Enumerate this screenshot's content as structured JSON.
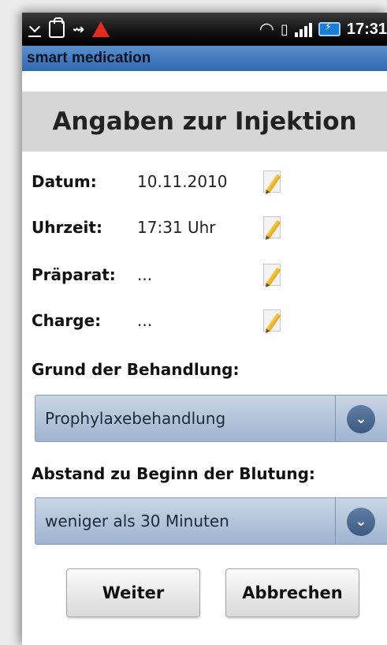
{
  "status_bar": {
    "time": "17:31",
    "icons": [
      "download-icon",
      "shopping-bag-icon",
      "usb-icon",
      "warning-icon",
      "wifi-icon",
      "vibrate-icon",
      "signal-icon",
      "battery-charging-icon"
    ]
  },
  "app": {
    "title": "smart medication"
  },
  "screen": {
    "heading": "Angaben zur Injektion"
  },
  "fields": [
    {
      "label": "Datum:",
      "value": "10.11.2010"
    },
    {
      "label": "Uhrzeit:",
      "value": "17:31 Uhr"
    },
    {
      "label": "Präparat:",
      "value": "..."
    },
    {
      "label": "Charge:",
      "value": "..."
    }
  ],
  "treatment_reason": {
    "label": "Grund der Behandlung:",
    "selected": "Prophylaxebehandlung"
  },
  "bleeding_interval": {
    "label": "Abstand zu Beginn der Blutung:",
    "selected": "weniger als 30 Minuten"
  },
  "buttons": {
    "next": "Weiter",
    "cancel": "Abbrechen"
  },
  "colors": {
    "title_bar": "#3e77bc",
    "spinner": "#b3c4da",
    "warning": "#e52b1b",
    "header": "#d6d6d6"
  }
}
